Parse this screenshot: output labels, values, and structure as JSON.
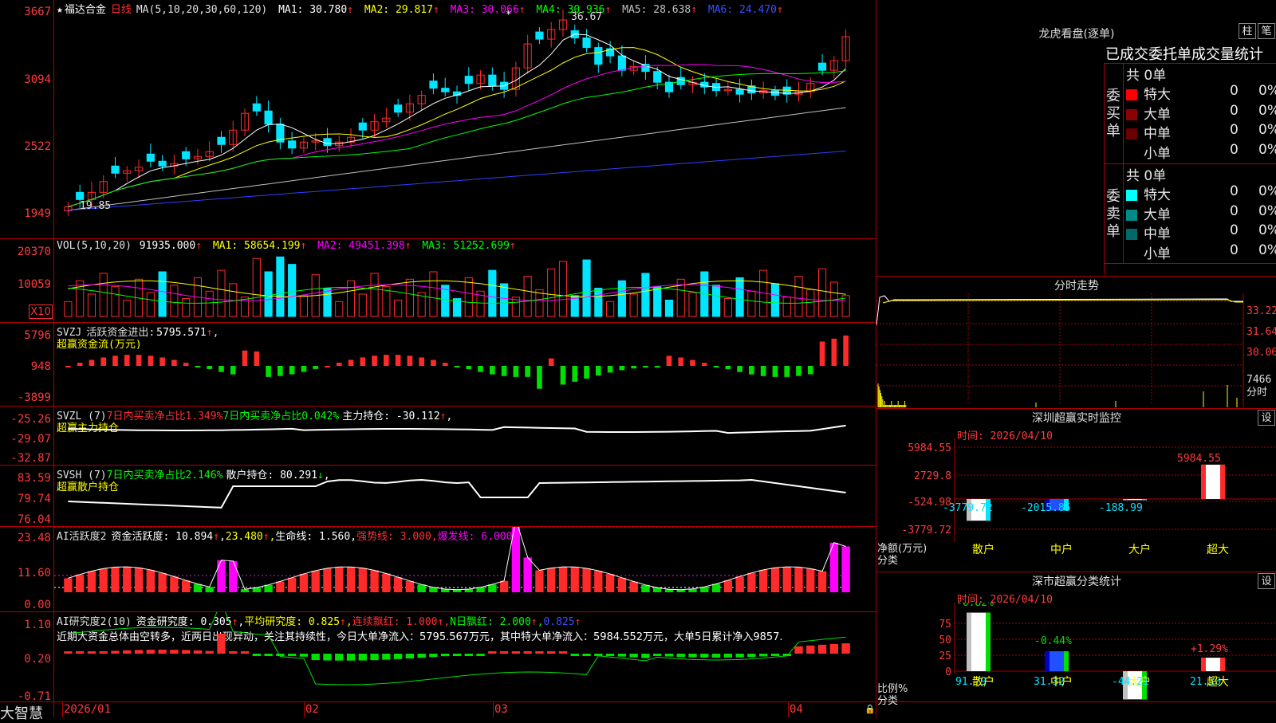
{
  "colors": {
    "up": "#ff2a2a",
    "down": "#00e5ff",
    "grid": "#b00000",
    "ma1": "#ffffff",
    "ma2": "#ffff00",
    "ma3": "#ff00ff",
    "ma4": "#00ff00",
    "ma5": "#c0c0c0",
    "ma6": "#3040ff"
  },
  "main": {
    "star": "★",
    "stock_name": "福达合金",
    "period": "日线",
    "ma_params": "MA(5,10,20,30,60,120)",
    "ma": [
      {
        "label": "MA1:",
        "value": "30.780"
      },
      {
        "label": "MA2:",
        "value": "29.817"
      },
      {
        "label": "MA3:",
        "value": "30.066"
      },
      {
        "label": "MA4:",
        "value": "30.936"
      },
      {
        "label": "MA5:",
        "value": "28.638"
      },
      {
        "label": "MA6:",
        "value": "24.470"
      }
    ],
    "arrow": "↑",
    "y_ticks": [
      "3667",
      "3094",
      "2522",
      "1949"
    ],
    "high_label": "36.67",
    "low_label": "19.85"
  },
  "vol": {
    "label": "VOL(5,10,20)",
    "value": "91935.000",
    "ma": [
      {
        "label": "MA1:",
        "value": "58654.199"
      },
      {
        "label": "MA2:",
        "value": "49451.398"
      },
      {
        "label": "MA3:",
        "value": "51252.699"
      }
    ],
    "y_ticks": [
      "20370",
      "10059"
    ],
    "unit": "X10"
  },
  "svzj": {
    "name": "SVZJ",
    "title": "活跃资金进出:",
    "value": "5795.571",
    "subtitle": "超赢资金流(万元)",
    "y_ticks": [
      "5796",
      "948",
      "-3899"
    ]
  },
  "svzl": {
    "name": "SVZL (7)",
    "t1": "7日内买卖净占比1.349%",
    "t2": "7日内买卖净占比0.042%",
    "t3": "主力持仓:",
    "v3": "-30.112",
    "subtitle": "超赢主力持仓",
    "y_ticks": [
      "-25.26",
      "-29.07",
      "-32.87"
    ]
  },
  "svsh": {
    "name": "SVSH (7)",
    "t1": "7日内买卖净占比2.146%",
    "t2": "散户持仓:",
    "v2": "80.291",
    "down": "↓",
    "subtitle": "超赢散户持仓",
    "y_ticks": [
      "83.59",
      "79.74",
      "76.04"
    ]
  },
  "ai1": {
    "name": "AI活跃度2",
    "l1": "资金活跃度:",
    "v1": "10.894",
    "v2": "23.480",
    "l3": "生命线:",
    "v3": "1.560",
    "l4": "强势线:",
    "v4": "3.000",
    "l5": "爆发线:",
    "v5": "6.000",
    "y_ticks": [
      "23.48",
      "11.60",
      "0.00"
    ]
  },
  "ai2": {
    "name": "AI研究度2(10)",
    "l1": "资金研究度:",
    "v1": "0.305",
    "l2": "平均研究度:",
    "v2": "0.825",
    "l3": "连续飘红:",
    "v3": "1.000",
    "l4": "N日飘红:",
    "v4": "2.000",
    "v5": "0.825",
    "y_ticks": [
      "1.10",
      "0.20",
      "-0.71"
    ],
    "text": "近期大资金总体由空转多，近两日出现异动，关注其持续性，今日大单净流入：5795.567万元，其中特大单净流入：5984.552万元，大单5日累计净入9857."
  },
  "x_dates": [
    "2026/01",
    "02",
    "03",
    "04"
  ],
  "brand": "大智慧",
  "longhu": {
    "title": "龙虎看盘(逐单)",
    "btn1": "柱",
    "btn2": "笔",
    "tabs": "已成交委托单成交量统计",
    "buy_side": "委买单",
    "sell_side": "委卖单",
    "buy_total": "共 0单",
    "sell_total": "共 0单",
    "buy_rows": [
      {
        "name": "特大",
        "count": "0",
        "pct": "0%",
        "color": "#ff0000"
      },
      {
        "name": "大单",
        "count": "0",
        "pct": "0%",
        "color": "#8b0000"
      },
      {
        "name": "中单",
        "count": "0",
        "pct": "0%",
        "color": "#6a0000"
      },
      {
        "name": "小单",
        "count": "0",
        "pct": "0%",
        "color": "#000000"
      }
    ],
    "sell_rows": [
      {
        "name": "特大",
        "count": "0",
        "pct": "0%",
        "color": "#00ffff"
      },
      {
        "name": "大单",
        "count": "0",
        "pct": "0%",
        "color": "#008b8b"
      },
      {
        "name": "中单",
        "count": "0",
        "pct": "0%",
        "color": "#006a6a"
      },
      {
        "name": "小单",
        "count": "0",
        "pct": "0%",
        "color": "#000000"
      }
    ]
  },
  "intraday": {
    "title": "分时走势",
    "ticks": [
      "33.22",
      "31.64",
      "30.06"
    ],
    "vol_tick": "7466",
    "label": "分时"
  },
  "sz_monitor": {
    "title": "深圳超赢实时监控",
    "set": "设",
    "time": "时间: 2026/04/10",
    "y_ticks": [
      "5984.55",
      "2729.8",
      "-524.98",
      "-3779.72"
    ],
    "ylabel1": "净额(万元)",
    "ylabel2": "分类",
    "cats": [
      "散户",
      "中户",
      "大户",
      "超大"
    ],
    "values": [
      -3779.72,
      -2015.85,
      -188.99,
      5984.55
    ],
    "value_labels": [
      "-3779.72",
      "-2015.85",
      "-188.99",
      "5984.55"
    ]
  },
  "sz_class": {
    "title": "深市超赢分类统计",
    "set": "设",
    "time": "时间: 2026/04/10",
    "y_ticks": [
      "75",
      "50",
      "25",
      "0"
    ],
    "ylabel1": "比例%",
    "ylabel2": "分类",
    "cats": [
      "散户",
      "中户",
      "大户",
      "超大"
    ],
    "values": [
      91.79,
      31.32,
      -44.21,
      21.1
    ],
    "value_labels": [
      "91.79",
      "31.32",
      "-44.21",
      "21.10"
    ],
    "pct_labels": [
      "-0.82%",
      "-0.44%",
      "",
      "+1.29%"
    ]
  },
  "chart_data": {
    "type": "candlestick",
    "title": "福达合金 日线",
    "x": [
      "2026/01",
      "02",
      "03",
      "04"
    ],
    "ylim": [
      19.49,
      36.67
    ],
    "high": 36.67,
    "low": 19.85,
    "series": [
      {
        "name": "MA1",
        "last": 30.78
      },
      {
        "name": "MA2",
        "last": 29.817
      },
      {
        "name": "MA3",
        "last": 30.066
      },
      {
        "name": "MA4",
        "last": 30.936
      },
      {
        "name": "MA5",
        "last": 28.638
      },
      {
        "name": "MA6",
        "last": 24.47
      }
    ],
    "closes": [
      20.2,
      20.8,
      21.4,
      22.3,
      23.0,
      23.2,
      23.5,
      24.0,
      23.6,
      23.8,
      24.2,
      24.4,
      24.8,
      25.4,
      26.6,
      28.0,
      28.2,
      27.1,
      25.6,
      25.1,
      25.6,
      25.7,
      25.3,
      25.6,
      26.0,
      26.6,
      27.3,
      27.6,
      28.1,
      28.8,
      29.5,
      30.1,
      29.8,
      29.5,
      30.5,
      31.2,
      30.3,
      30.0,
      31.8,
      33.8,
      34.2,
      35.0,
      35.8,
      34.3,
      33.5,
      32.1,
      32.8,
      31.6,
      31.9,
      31.5,
      30.6,
      29.8,
      30.4,
      30.6,
      30.2,
      29.9,
      30.0,
      29.6,
      29.7,
      29.9,
      29.5,
      29.6,
      29.8,
      30.5,
      31.6,
      32.4,
      34.4
    ]
  }
}
